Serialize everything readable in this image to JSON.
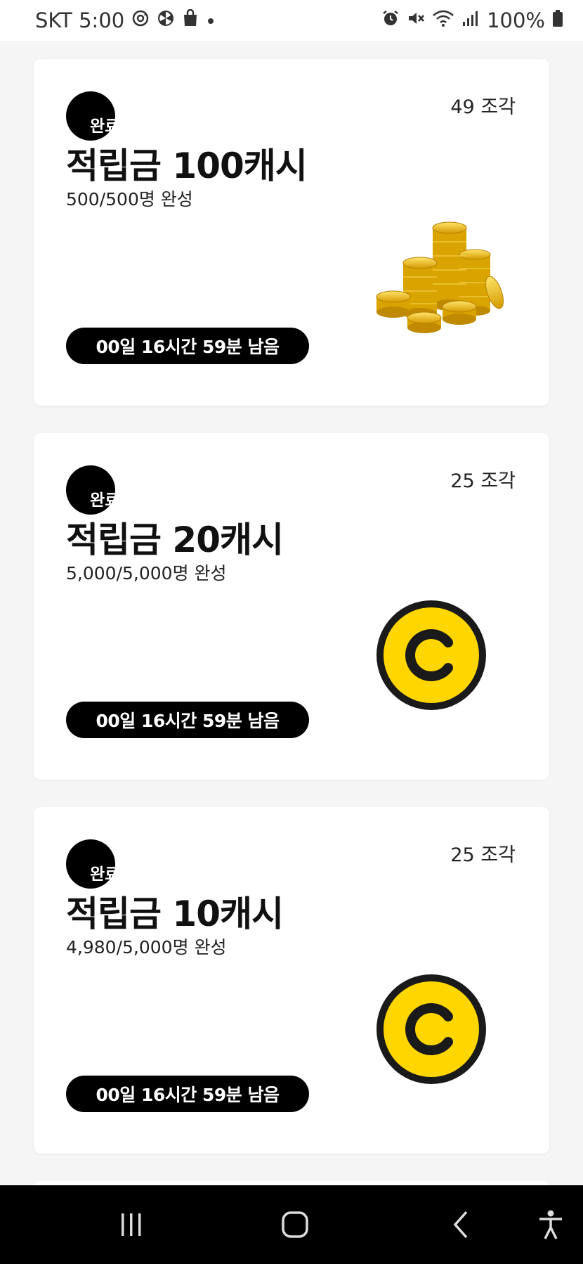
{
  "status": {
    "carrier_time": "SKT 5:00",
    "battery": "100%",
    "icons_left": [
      "sync-icon",
      "fan-icon",
      "shopping-bag-icon",
      "dot-icon"
    ],
    "icons_right": [
      "alarm-icon",
      "mute-icon",
      "wifi-icon",
      "signal-icon",
      "battery-icon"
    ]
  },
  "cards": [
    {
      "pieces": "49 조각",
      "badge": "완료",
      "title": "적립금 100캐시",
      "progress": "500/500명 완성",
      "timer": "00일 16시간 59분 남음",
      "image": "coin-stack-icon"
    },
    {
      "pieces": "25 조각",
      "badge": "완료",
      "title": "적립금 20캐시",
      "progress": "5,000/5,000명 완성",
      "timer": "00일 16시간 59분 남음",
      "image": "cash-coin-icon"
    },
    {
      "pieces": "25 조각",
      "badge": "완료",
      "title": "적립금 10캐시",
      "progress": "4,980/5,000명 완성",
      "timer": "00일 16시간 59분 남음",
      "image": "cash-coin-icon"
    }
  ],
  "navigation": {
    "recents": "recent-apps-icon",
    "home": "home-icon",
    "back": "back-icon",
    "accessibility": "accessibility-icon"
  },
  "colors": {
    "coin_yellow": "#FFD600",
    "coin_gold": "#E8B400",
    "badge_black": "#000000",
    "background": "#F5F5F5"
  }
}
